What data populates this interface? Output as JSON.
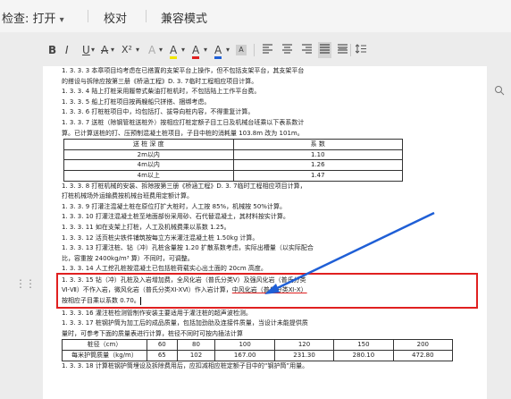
{
  "toolbar": {
    "check_label": "检查: 打开",
    "check_dropdown_icon": "chevron-down-icon",
    "proofread_label": "校对",
    "compat_label": "兼容模式"
  },
  "format_bar": {
    "bold": "B",
    "italic": "I",
    "underline": "U",
    "strike": "A",
    "superscript": "X²",
    "clear": "A",
    "highlight": "A",
    "font_color": "A",
    "text_effect": "A",
    "accent_color": "#1f5fd6",
    "highlight_color": "#f2e600",
    "font_color_value": "#e02020"
  },
  "document": {
    "paragraphs": [
      "1. 3. 3. 3 本章项目均考虑在已搭置的支架平台上操作，但不包括支架平台，其支架平台",
      "的搭设与拆除应按第三册《桥涵工程》D. 3. 7临时工程相应项目计算。",
      "1. 3. 3. 4 陆上打桩采用履带式柴油打桩机时，不包括陆上工作平台费。",
      "1. 3. 3. 5 船上打桩项目按两艘船只拼搭、捆绑考虑。",
      "1. 3. 3. 6 打桩桩项目中，均包括打、拔导向桩内容，不得重复计算。",
      "1. 3. 3. 7 送桩（除钢管桩送桩外）按相应打桩定额子目工日及机械台班乘以下表系数计",
      "算。已计算送桩的打、压预制混凝土桩项目，子目中桩的消耗量 103.8m 改为 101m。"
    ],
    "table1": {
      "headers": [
        "送 桩 深 度",
        "系 数"
      ],
      "rows": [
        [
          "2m以内",
          "1.10"
        ],
        [
          "4m以内",
          "1.26"
        ],
        [
          "4m以上",
          "1.47"
        ]
      ]
    },
    "paragraphs2": [
      "1. 3. 3. 8 打桩机械的安装、拆除按第三册《桥涵工程》D. 3. 7临时工程相应项目计算，",
      "打桩机械场外运输费按机械台班费用定额计算。",
      "1. 3. 3. 9 打灌注混凝土桩在原位打扩大桩时，人工按 85%，机械按 50%计算。",
      "1. 3. 3. 10 打灌注混凝土桩至地面部份采用砂、石代替混凝土，其材料按实计算。",
      "1. 3. 3. 11  如在支架上打桩，人工及机械费乘以系数 1.25。",
      "1. 3. 3. 12 活页桩尖铁件铺筑按每立方米灌注混凝土桩 1.50kg 计算。",
      "1. 3. 3. 13 打灌注桩、钻（冲）孔桩含量按 1.20 扩散系数考虑，实际出槽量（以实际配合",
      "比，容重按 2400kg/m³ 算）不同时，可调整。",
      "1. 3. 3. 14 人工挖孔桩按混凝土已包括桩荷载实心出土面的 20cm 高度。"
    ],
    "highlighted_paragraph": {
      "part1": "1. 3. 3. 15 钻（冲）孔桩及入岩增加费，全风化岩（普氏分类Ⅴ）及强风化岩（普氏分类",
      "part2": "Ⅵ-Ⅶ）不作入岩，微风化岩（普氏分类Ⅺ-XⅥ）作入岩计算，",
      "part2_underlined": "中风化岩（普氏分类Ⅺ-Ⅹ）",
      "part3": "按相应子目乘以系数 0.70。"
    },
    "paragraphs3": [
      "1. 3. 3. 16 灌注桩检测管制作安装主要适用于灌注桩的超声波检测。",
      "1. 3. 3. 17 桩钢护筒为加工后的成品质量，包括加劲肋及连接件质量，当设计未能提供质",
      "量时，可参考下面的质量表进行计算，桩径不同时可按内插法计算"
    ],
    "table2": {
      "header_label": "桩径（cm）",
      "diameters": [
        "60",
        "80",
        "100",
        "120",
        "150",
        "200"
      ],
      "row_label": "每米护筒质量（kg/m）",
      "masses": [
        "65",
        "102",
        "167.00",
        "231.30",
        "280.10",
        "472.80"
      ]
    },
    "last_paragraph": "1. 3. 3. 18 计算桩钢护筒埋设及拆除费用后，应扣减相应桩定额子目中的“钢护筒”用量。"
  },
  "annotation": {
    "box_color": "#e02020",
    "arrow_color": "#1f5fd6"
  }
}
